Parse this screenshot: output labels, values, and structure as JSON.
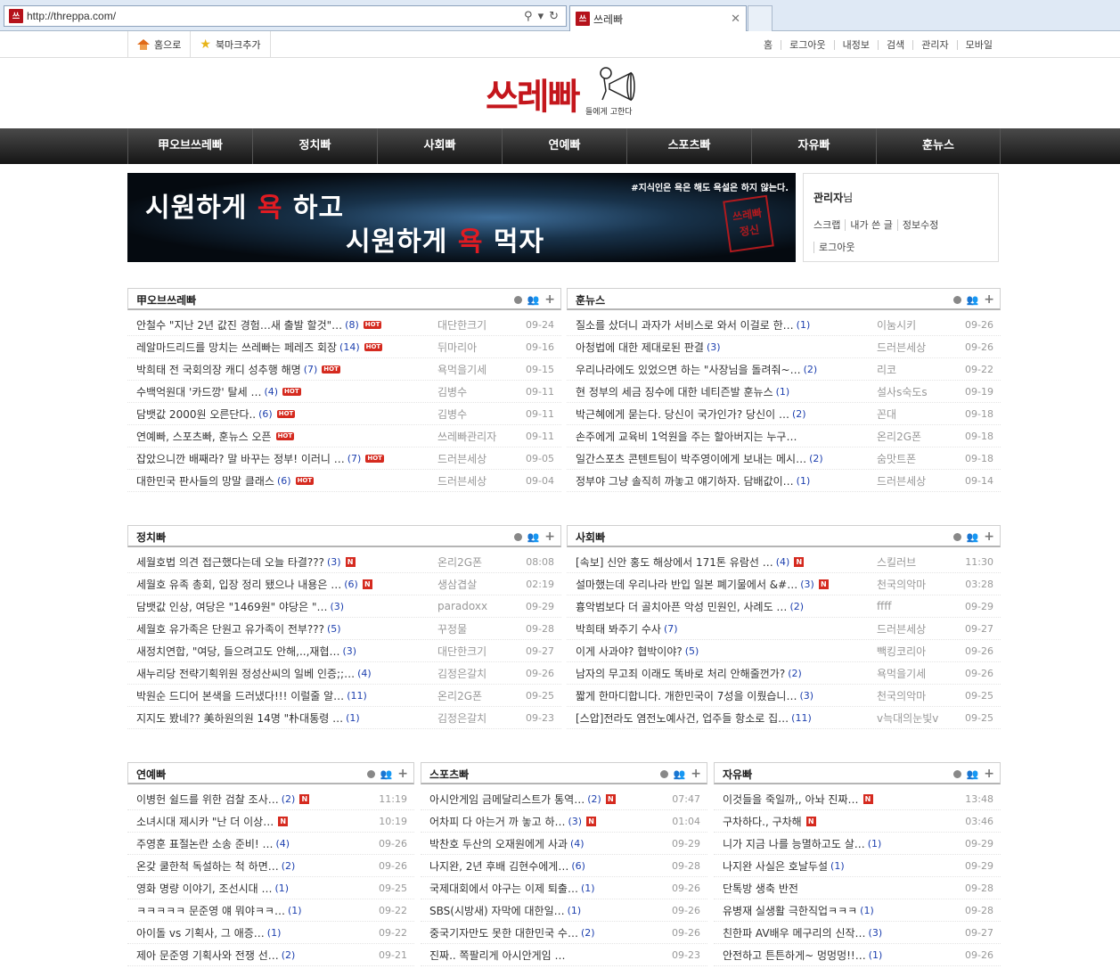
{
  "browser": {
    "url": "http://threppa.com/",
    "tab_title": "쓰레빠",
    "favicon_text": "쓰"
  },
  "topbar": {
    "home": "홈으로",
    "bookmark": "북마크추가",
    "right_links": [
      "홈",
      "로그아웃",
      "내정보",
      "검색",
      "관리자",
      "모바일"
    ]
  },
  "logo": {
    "main": "쓰레빠",
    "sub": "들에게 고한다"
  },
  "nav": [
    "甲오브쓰레빠",
    "정치빠",
    "사회빠",
    "연예빠",
    "스포츠빠",
    "자유빠",
    "훈뉴스"
  ],
  "banner": {
    "quote": "#지식인은 욕은 해도 욕설은 하지 않는다.",
    "line1_a": "시원하게 ",
    "line1_b": "욕",
    "line1_c": " 하고",
    "line2_a": "시원하게 ",
    "line2_b": "욕",
    "line2_c": " 먹자",
    "seal": "쓰레빠 정신"
  },
  "userbox": {
    "name": "관리자",
    "suffix": "님",
    "links": [
      "스크랩",
      "내가 쓴 글",
      "정보수정",
      "로그아웃"
    ]
  },
  "boards": [
    {
      "title": "甲오브쓰레빠",
      "rows": [
        {
          "t": "안철수 \"지난 2년 값진 경험…새 출발 할것\"…",
          "c": "(8)",
          "b": "HOT",
          "a": "대단한크기",
          "d": "09-24"
        },
        {
          "t": "레알마드리드를 망치는 쓰레빠는 페레즈 회장",
          "c": "(14)",
          "b": "HOT",
          "a": "뒤마리아",
          "d": "09-16"
        },
        {
          "t": "박희태 전 국회의장 캐디 성추행 해명",
          "c": "(7)",
          "b": "HOT",
          "a": "욕먹을기세",
          "d": "09-15"
        },
        {
          "t": "수백억원대 '카드깡' 탈세 …",
          "c": "(4)",
          "b": "HOT",
          "a": "김병수",
          "d": "09-11"
        },
        {
          "t": "담뱃값 2000원 오른단다..",
          "c": "(6)",
          "b": "HOT",
          "a": "김병수",
          "d": "09-11"
        },
        {
          "t": "연예빠, 스포츠빠, 훈뉴스 오픈",
          "c": "",
          "b": "HOT",
          "a": "쓰레빠관리자",
          "d": "09-11"
        },
        {
          "t": "잡았으니깐 배째라? 말 바꾸는 정부! 이러니 …",
          "c": "(7)",
          "b": "HOT",
          "a": "드러븐세상",
          "d": "09-05"
        },
        {
          "t": "대한민국 판사들의 망말 클래스",
          "c": "(6)",
          "b": "HOT",
          "a": "드러븐세상",
          "d": "09-04"
        }
      ]
    },
    {
      "title": "훈뉴스",
      "rows": [
        {
          "t": "질소를 샀더니 과자가 서비스로 와서 이걸로 한…",
          "c": "(1)",
          "b": "",
          "a": "이눔시키",
          "d": "09-26"
        },
        {
          "t": "아청법에 대한 제대로된 판결",
          "c": "(3)",
          "b": "",
          "a": "드러븐세상",
          "d": "09-26"
        },
        {
          "t": "우리나라에도 있었으면 하는 \"사장님을 돌려줘~…",
          "c": "(2)",
          "b": "",
          "a": "리코",
          "d": "09-22"
        },
        {
          "t": "현 정부의 세금 징수에 대한 네티즌발 훈뉴스",
          "c": "(1)",
          "b": "",
          "a": "설사s숙도s",
          "d": "09-19"
        },
        {
          "t": "박근혜에게 묻는다. 당신이 국가인가? 당신이 …",
          "c": "(2)",
          "b": "",
          "a": "꼰대",
          "d": "09-18"
        },
        {
          "t": "손주에게 교육비 1억원을 주는 할아버지는 누구…",
          "c": "",
          "b": "",
          "a": "온리2G폰",
          "d": "09-18"
        },
        {
          "t": "일간스포츠 콘텐트팀이 박주영이에게 보내는 메시…",
          "c": "(2)",
          "b": "",
          "a": "숨맛트폰",
          "d": "09-18"
        },
        {
          "t": "정부야 그냥 솔직히 까놓고 얘기하자. 담배값이…",
          "c": "(1)",
          "b": "",
          "a": "드러븐세상",
          "d": "09-14"
        }
      ]
    },
    {
      "title": "정치빠",
      "rows": [
        {
          "t": "세월호법 의견 접근했다는데 오늘 타결???",
          "c": "(3)",
          "b": "N",
          "a": "온리2G폰",
          "d": "08:08"
        },
        {
          "t": "세월호 유족 총회, 입장 정리 됐으나 내용은 …",
          "c": "(6)",
          "b": "N",
          "a": "생삼겹살",
          "d": "02:19"
        },
        {
          "t": "담뱃값 인상, 여당은 \"1469원\" 야당은 \"…",
          "c": "(3)",
          "b": "",
          "a": "paradoxx",
          "d": "09-29"
        },
        {
          "t": "세월호 유가족은 단원고 유가족이 전부???",
          "c": "(5)",
          "b": "",
          "a": "꾸정물",
          "d": "09-28"
        },
        {
          "t": "새정치연합, \"여당, 들으려고도 안해,..,재협…",
          "c": "(3)",
          "b": "",
          "a": "대단한크기",
          "d": "09-27"
        },
        {
          "t": "새누리당 전략기획위원 정성산씨의 일베 인증;;…",
          "c": "(4)",
          "b": "",
          "a": "김정은갈치",
          "d": "09-26"
        },
        {
          "t": "박원순 드디어 본색을 드러냈다!!! 이럴줄 알…",
          "c": "(11)",
          "b": "",
          "a": "온리2G폰",
          "d": "09-25"
        },
        {
          "t": "지지도 봤네?? 美하원의원 14명 \"朴대통령 …",
          "c": "(1)",
          "b": "",
          "a": "김정은갈치",
          "d": "09-23"
        }
      ]
    },
    {
      "title": "사회빠",
      "rows": [
        {
          "t": "[속보] 신안 홍도 해상에서 171톤 유람선 …",
          "c": "(4)",
          "b": "N",
          "a": "스킬러브",
          "d": "11:30"
        },
        {
          "t": "설마했는데 우리나라 반입 일본 폐기물에서 &#…",
          "c": "(3)",
          "b": "N",
          "a": "천국의악마",
          "d": "03:28"
        },
        {
          "t": "흉악범보다 더 골치아픈 악성 민원인, 사례도 …",
          "c": "(2)",
          "b": "",
          "a": "ffff",
          "d": "09-29"
        },
        {
          "t": "박희태 봐주기 수사",
          "c": "(7)",
          "b": "",
          "a": "드러븐세상",
          "d": "09-27"
        },
        {
          "t": "이게 사과야? 협박이야?",
          "c": "(5)",
          "b": "",
          "a": "빽킹코리아",
          "d": "09-26"
        },
        {
          "t": "남자의 무고죄 이래도 똑바로 처리 안해줄껀가?",
          "c": "(2)",
          "b": "",
          "a": "욕먹을기세",
          "d": "09-26"
        },
        {
          "t": "짧게 한마디합니다. 개한민국이 7성을 이뤘습니…",
          "c": "(3)",
          "b": "",
          "a": "천국의악마",
          "d": "09-25"
        },
        {
          "t": "[스압]전라도 염전노예사건, 업주들 항소로 집…",
          "c": "(11)",
          "b": "",
          "a": "v늑대의눈빛v",
          "d": "09-25"
        }
      ]
    },
    {
      "title": "연예빠",
      "rows": [
        {
          "t": "이병헌 쉴드를 위한 검찰 조사…",
          "c": "(2)",
          "b": "N",
          "a": "",
          "d": "11:19"
        },
        {
          "t": "소녀시대 제시카 \"난 더 이상…",
          "c": "",
          "b": "N",
          "a": "",
          "d": "10:19"
        },
        {
          "t": "주영훈 표절논란 소송 준비! …",
          "c": "(4)",
          "b": "",
          "a": "",
          "d": "09-26"
        },
        {
          "t": "온갖 쿨한척 독설하는 척 하면…",
          "c": "(2)",
          "b": "",
          "a": "",
          "d": "09-26"
        },
        {
          "t": "영화 명량 이야기, 조선시대 …",
          "c": "(1)",
          "b": "",
          "a": "",
          "d": "09-25"
        },
        {
          "t": "ㅋㅋㅋㅋㅋ 문준영 얘 뭐야ㅋㅋ…",
          "c": "(1)",
          "b": "",
          "a": "",
          "d": "09-22"
        },
        {
          "t": "아이돌 vs 기획사, 그 애증…",
          "c": "(1)",
          "b": "",
          "a": "",
          "d": "09-22"
        },
        {
          "t": "제아 문준영 기획사와 전쟁 선…",
          "c": "(2)",
          "b": "",
          "a": "",
          "d": "09-21"
        }
      ]
    },
    {
      "title": "스포츠빠",
      "rows": [
        {
          "t": "아시안게임 금메달리스트가 통역…",
          "c": "(2)",
          "b": "N",
          "a": "",
          "d": "07:47"
        },
        {
          "t": "어차피 다 아는거 까 놓고 하…",
          "c": "(3)",
          "b": "N",
          "a": "",
          "d": "01:04"
        },
        {
          "t": "박찬호 두산의 오재원에게 사과",
          "c": "(4)",
          "b": "",
          "a": "",
          "d": "09-29"
        },
        {
          "t": "나지완, 2년 후배 김현수에게…",
          "c": "(6)",
          "b": "",
          "a": "",
          "d": "09-28"
        },
        {
          "t": "국제대회에서 야구는 이제 퇴출…",
          "c": "(1)",
          "b": "",
          "a": "",
          "d": "09-26"
        },
        {
          "t": "SBS(시방새) 자막에 대한일…",
          "c": "(1)",
          "b": "",
          "a": "",
          "d": "09-26"
        },
        {
          "t": "중국기자만도 못한 대한민국 수…",
          "c": "(2)",
          "b": "",
          "a": "",
          "d": "09-26"
        },
        {
          "t": "진짜.. 쪽팔리게 아시안게임 …",
          "c": "",
          "b": "",
          "a": "",
          "d": "09-23"
        }
      ]
    },
    {
      "title": "자유빠",
      "rows": [
        {
          "t": "이것들을 죽일까,, 아놔 진짜…",
          "c": "",
          "b": "N",
          "a": "",
          "d": "13:48"
        },
        {
          "t": "구차하다., 구차해",
          "c": "",
          "b": "N",
          "a": "",
          "d": "03:46"
        },
        {
          "t": "니가 지금 나를 능멸하고도 살…",
          "c": "(1)",
          "b": "",
          "a": "",
          "d": "09-29"
        },
        {
          "t": "나지완 사실은 호날두설",
          "c": "(1)",
          "b": "",
          "a": "",
          "d": "09-29"
        },
        {
          "t": "단톡방 생축 반전",
          "c": "",
          "b": "",
          "a": "",
          "d": "09-28"
        },
        {
          "t": "유병재 실생활 극한직업ㅋㅋㅋ",
          "c": "(1)",
          "b": "",
          "a": "",
          "d": "09-28"
        },
        {
          "t": "친한파 AV배우 메구리의 신작…",
          "c": "(3)",
          "b": "",
          "a": "",
          "d": "09-27"
        },
        {
          "t": "안전하고 튼튼하게~ 멍멍멍!!…",
          "c": "(1)",
          "b": "",
          "a": "",
          "d": "09-26"
        }
      ]
    }
  ]
}
